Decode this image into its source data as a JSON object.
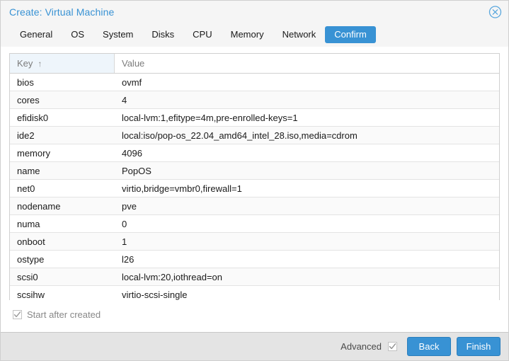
{
  "window": {
    "title": "Create: Virtual Machine",
    "close_icon": "close-circle-icon"
  },
  "tabs": [
    {
      "label": "General",
      "active": false
    },
    {
      "label": "OS",
      "active": false
    },
    {
      "label": "System",
      "active": false
    },
    {
      "label": "Disks",
      "active": false
    },
    {
      "label": "CPU",
      "active": false
    },
    {
      "label": "Memory",
      "active": false
    },
    {
      "label": "Network",
      "active": false
    },
    {
      "label": "Confirm",
      "active": true
    }
  ],
  "grid": {
    "columns": [
      {
        "label": "Key",
        "sorted": true,
        "sort_arrow": "↑"
      },
      {
        "label": "Value",
        "sorted": false,
        "sort_arrow": ""
      }
    ],
    "rows": [
      {
        "key": "bios",
        "value": "ovmf"
      },
      {
        "key": "cores",
        "value": "4"
      },
      {
        "key": "efidisk0",
        "value": "local-lvm:1,efitype=4m,pre-enrolled-keys=1"
      },
      {
        "key": "ide2",
        "value": "local:iso/pop-os_22.04_amd64_intel_28.iso,media=cdrom"
      },
      {
        "key": "memory",
        "value": "4096"
      },
      {
        "key": "name",
        "value": "PopOS"
      },
      {
        "key": "net0",
        "value": "virtio,bridge=vmbr0,firewall=1"
      },
      {
        "key": "nodename",
        "value": "pve"
      },
      {
        "key": "numa",
        "value": "0"
      },
      {
        "key": "onboot",
        "value": "1"
      },
      {
        "key": "ostype",
        "value": "l26"
      },
      {
        "key": "scsi0",
        "value": "local-lvm:20,iothread=on"
      },
      {
        "key": "scsihw",
        "value": "virtio-scsi-single"
      }
    ]
  },
  "start_after_created": {
    "label": "Start after created",
    "checked": true
  },
  "footer": {
    "advanced_label": "Advanced",
    "advanced_checked": true,
    "back_label": "Back",
    "finish_label": "Finish"
  },
  "colors": {
    "accent": "#3892d4",
    "title_text": "#3892d4",
    "header_bg": "#f5f5f5",
    "footer_bg": "#e4e4e4",
    "sorted_column_bg": "#eef5fb"
  }
}
